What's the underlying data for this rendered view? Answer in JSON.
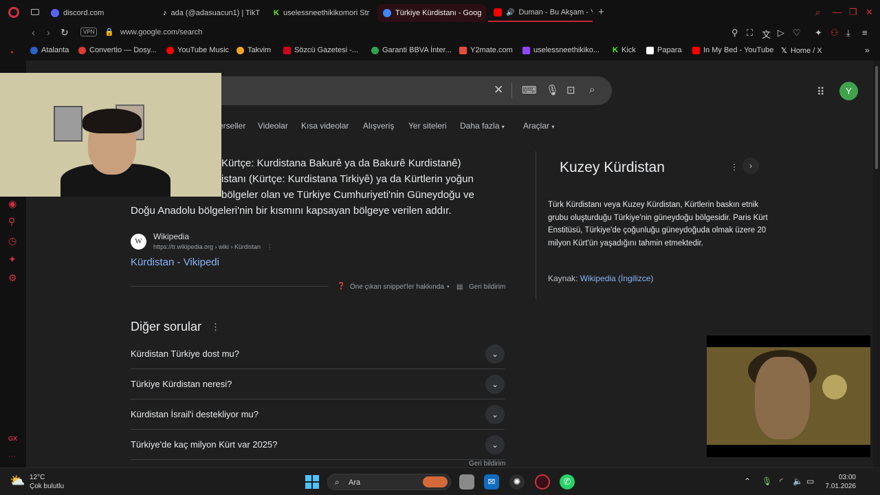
{
  "browser": {
    "tabs": [
      {
        "label": "discord.com",
        "color": "#5865f2"
      },
      {
        "label": "ada (@adasuacun1) | TikT",
        "color": "#111111"
      },
      {
        "label": "uselessneethikikomori Str",
        "color": "#53fc18"
      },
      {
        "label": "Türkiye Kürdistanı - Goog",
        "color": "#4285f4"
      },
      {
        "label": "Duman - Bu Akşam - Y",
        "color": "#ff0000"
      }
    ],
    "new_tab": "+",
    "url": "www.google.com/search",
    "vpn_label": "VPN",
    "bookmarks": [
      {
        "label": "Atalanta",
        "color": "#2a62c9"
      },
      {
        "label": "Convertio — Dosy...",
        "color": "#e03c31"
      },
      {
        "label": "YouTube Music",
        "color": "#ff0000"
      },
      {
        "label": "Takvim",
        "color": "#f5a623"
      },
      {
        "label": "Sözcü Gazetesi -...",
        "color": "#d0021b"
      },
      {
        "label": "Garanti BBVA İnter...",
        "color": "#2ea44f"
      },
      {
        "label": "Y2mate.com",
        "color": "#e74c3c"
      },
      {
        "label": "uselessneethikiko...",
        "color": "#9146ff"
      },
      {
        "label": "Kick",
        "color": "#53fc18"
      },
      {
        "label": "Papara",
        "color": "#ffffff"
      },
      {
        "label": "In My Bed - YouTube",
        "color": "#ff0000"
      },
      {
        "label": "Home / X",
        "color": "#ffffff"
      }
    ]
  },
  "google": {
    "tabs": [
      "erseller",
      "Videolar",
      "Kısa videolar",
      "Alışveriş",
      "Yer siteleri",
      "Daha fazla",
      "Araçlar"
    ],
    "avatar_letter": "Y",
    "snippet_lines": [
      "Kürtçe: Kurdistana Bakurê ya da Bakurê Kurdistanê)",
      "istanı (Kürtçe: Kurdistana Tirkiyê) ya da Kürtlerin yoğun",
      "bölgeler olan ve Türkiye Cumhuriyeti'nin Güneydoğu ve",
      "Doğu Anadolu bölgeleri'nin bir kısmını kapsayan bölgeye verilen addır."
    ],
    "source_name": "Wikipedia",
    "source_url": "https://tr.wikipedia.org › wiki › Kürdistan",
    "result_title": "Kürdistan - Vikipedi",
    "snippet_about": "Öne çıkan snippet'ler hakkında",
    "feedback": "Geri bildirim",
    "paa_title": "Diğer sorular",
    "questions": [
      "Kürdistan Türkiye dost mu?",
      "Türkiye Kürdistan neresi?",
      "Kürdistan İsrail'i destekliyor mu?",
      "Türkiye'de kaç milyon Kürt var 2025?"
    ],
    "knowledge_panel": {
      "title": "Kuzey Kürdistan",
      "description": "Türk Kürdistanı veya Kuzey Kürdistan, Kürtlerin baskın etnik grubu oluşturduğu Türkiye'nin güneydoğu bölgesidir. Paris Kürt Enstitüsü, Türkiye'de çoğunluğu güneydoğuda olmak üzere 20 milyon Kürt'ün yaşadığını tahmin etmektedir.",
      "source_prefix": "Kaynak:",
      "source_link": "Wikipedia (İngilizce)"
    }
  },
  "taskbar": {
    "temperature": "12°C",
    "condition": "Çok bulutlu",
    "search_label": "Ara",
    "time": "03:00",
    "date": "7.01.2026"
  }
}
